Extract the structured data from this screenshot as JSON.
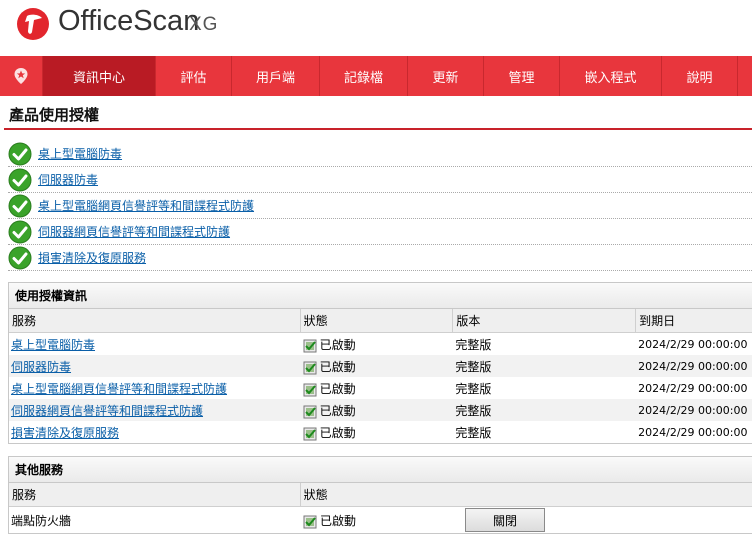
{
  "header": {
    "brand_name": "OfficeScan",
    "brand_suffix": "XG"
  },
  "nav": {
    "home_icon": "home-badge-icon",
    "items": [
      {
        "label": "資訊中心",
        "active": true
      },
      {
        "label": "評估",
        "active": false
      },
      {
        "label": "用戶端",
        "active": false
      },
      {
        "label": "記錄檔",
        "active": false
      },
      {
        "label": "更新",
        "active": false
      },
      {
        "label": "管理",
        "active": false
      },
      {
        "label": "嵌入程式",
        "active": false
      },
      {
        "label": "說明",
        "active": false
      }
    ]
  },
  "page": {
    "title": "產品使用授權"
  },
  "products": [
    {
      "label": "桌上型電腦防毒",
      "icon": "check-circle-icon"
    },
    {
      "label": "伺服器防毒",
      "icon": "check-circle-icon"
    },
    {
      "label": "桌上型電腦網頁信譽評等和間諜程式防護",
      "icon": "check-circle-icon"
    },
    {
      "label": "伺服器網頁信譽評等和間諜程式防護",
      "icon": "check-circle-icon"
    },
    {
      "label": "損害清除及復原服務",
      "icon": "check-circle-icon"
    }
  ],
  "license_table": {
    "title": "使用授權資訊",
    "columns": [
      "服務",
      "狀態",
      "版本",
      "到期日"
    ],
    "rows": [
      {
        "service": "桌上型電腦防毒",
        "status": "已啟動",
        "version": "完整版",
        "expiry": "2024/2/29 00:00:00"
      },
      {
        "service": "伺服器防毒",
        "status": "已啟動",
        "version": "完整版",
        "expiry": "2024/2/29 00:00:00"
      },
      {
        "service": "桌上型電腦網頁信譽評等和間諜程式防護",
        "status": "已啟動",
        "version": "完整版",
        "expiry": "2024/2/29 00:00:00"
      },
      {
        "service": "伺服器網頁信譽評等和間諜程式防護",
        "status": "已啟動",
        "version": "完整版",
        "expiry": "2024/2/29 00:00:00"
      },
      {
        "service": "損害清除及復原服務",
        "status": "已啟動",
        "version": "完整版",
        "expiry": "2024/2/29 00:00:00"
      }
    ]
  },
  "other_services": {
    "title": "其他服務",
    "columns": [
      "服務",
      "狀態"
    ],
    "rows": [
      {
        "service": "端點防火牆",
        "status": "已啟動",
        "action": "關閉"
      }
    ]
  },
  "colors": {
    "brand_red": "#e8363d",
    "active_nav": "#b91b24",
    "link": "#0a5fa8",
    "check_green": "#3aa32a"
  }
}
